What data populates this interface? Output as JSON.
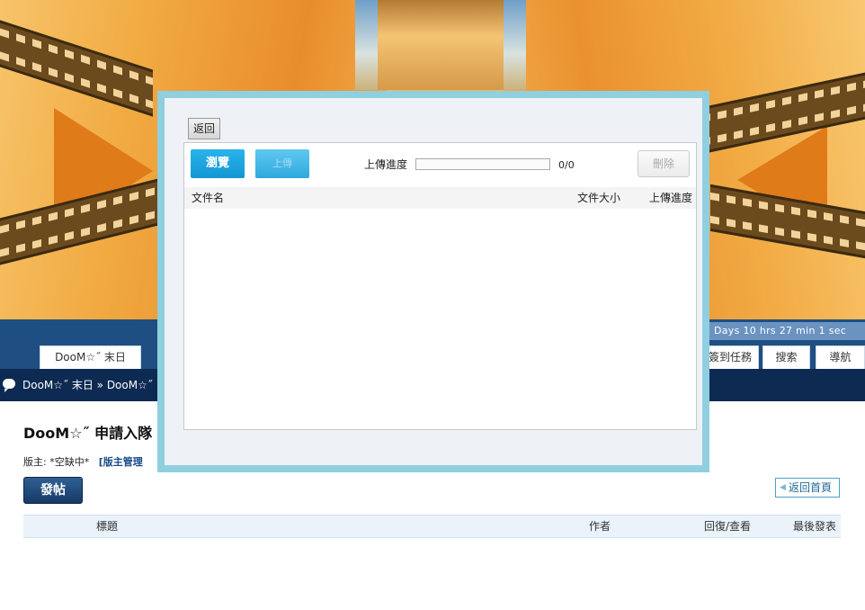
{
  "header": {
    "timer": "Days 10 hrs 27 min 1 sec",
    "nav_tabs": [
      {
        "label": "DooM☆˝ 末日"
      },
      {
        "label": "簽到任務"
      },
      {
        "label": "搜索"
      },
      {
        "label": "導航"
      }
    ]
  },
  "breadcrumb": "DooM☆˝ 末日 » DooM☆˝",
  "forum": {
    "title": "DooM☆˝ 申請入隊",
    "moderator_label": "版主: *空缺中*",
    "moderator_manage": "[版主管理",
    "post_button": "發帖",
    "home_button": "返回首頁",
    "table_headers": {
      "title": "標題",
      "author": "作者",
      "replies": "回復/查看",
      "last_post": "最後發表"
    }
  },
  "upload_dialog": {
    "back_label": "返回",
    "browse_label": "瀏覽",
    "upload_label": "上傳",
    "progress_label": "上傳進度",
    "progress_count": "0/0",
    "progress_fraction": 0,
    "delete_label": "刪除",
    "columns": {
      "name": "文件名",
      "size": "文件大小",
      "progress": "上傳進度"
    },
    "files": []
  },
  "colors": {
    "nav_band": "#1f4f82",
    "crumb_bar": "#0d2b52",
    "dialog_border": "#8fcfe0",
    "primary_button": "#1396d3"
  }
}
